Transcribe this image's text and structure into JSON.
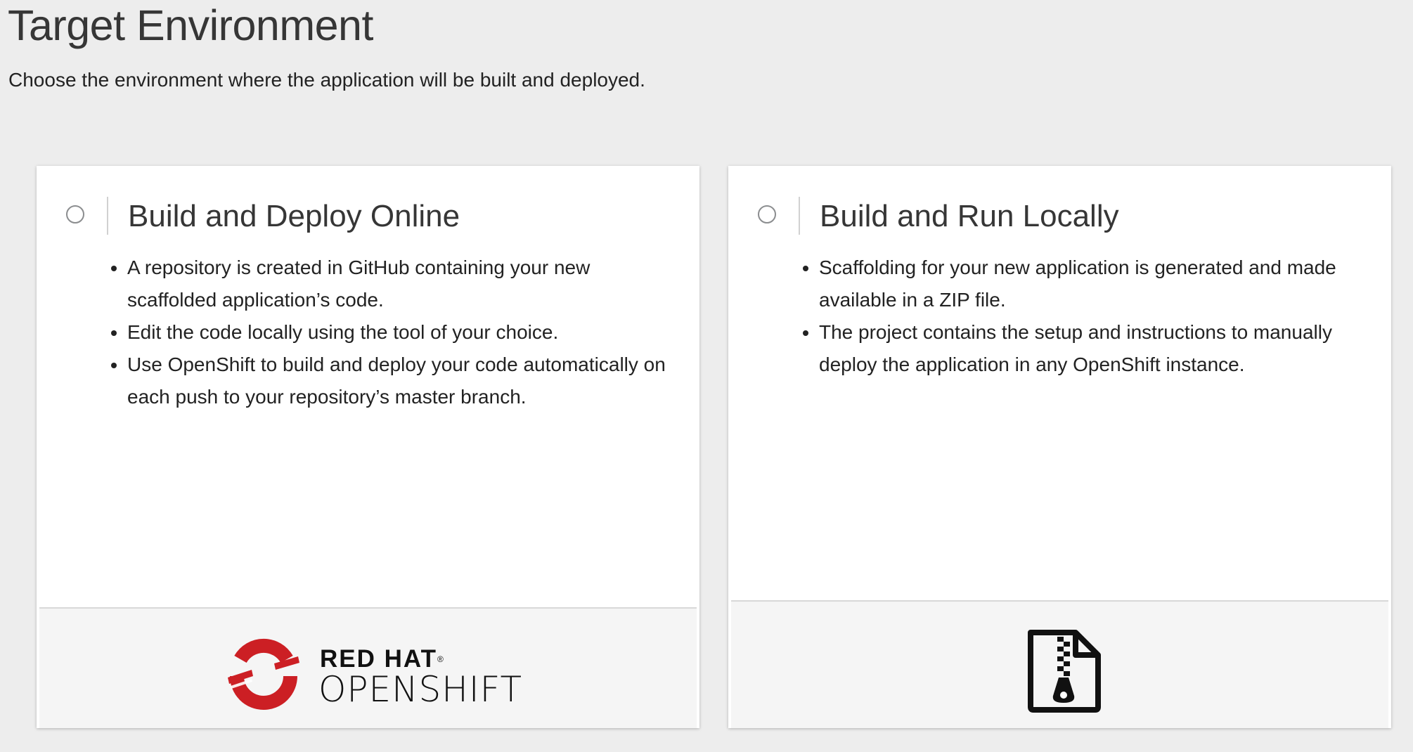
{
  "page": {
    "title": "Target Environment",
    "subtitle": "Choose the environment where the application will be built and deployed."
  },
  "options": [
    {
      "title": "Build and Deploy Online",
      "selected": false,
      "bullets": [
        "A repository is created in GitHub containing your new scaffolded application’s code.",
        "Edit the code locally using the tool of your choice.",
        "Use OpenShift to build and deploy your code automatically on each push to your repository’s master branch."
      ],
      "footer": {
        "logo_icon": "red-hat-openshift-logo",
        "logo_line1": "RED HAT",
        "logo_mark": "®",
        "logo_line2": "OPENSHIFT"
      }
    },
    {
      "title": "Build and Run Locally",
      "selected": false,
      "bullets": [
        "Scaffolding for your new application is generated and made available in a ZIP file.",
        "The project contains the setup and instructions to manually deploy the application in any OpenShift instance."
      ],
      "footer": {
        "icon": "zip-file-icon"
      }
    }
  ],
  "colors": {
    "background": "#ededed",
    "card": "#ffffff",
    "footer": "#f5f5f5",
    "openshift_red": "#cc1f24",
    "text": "#222222"
  }
}
